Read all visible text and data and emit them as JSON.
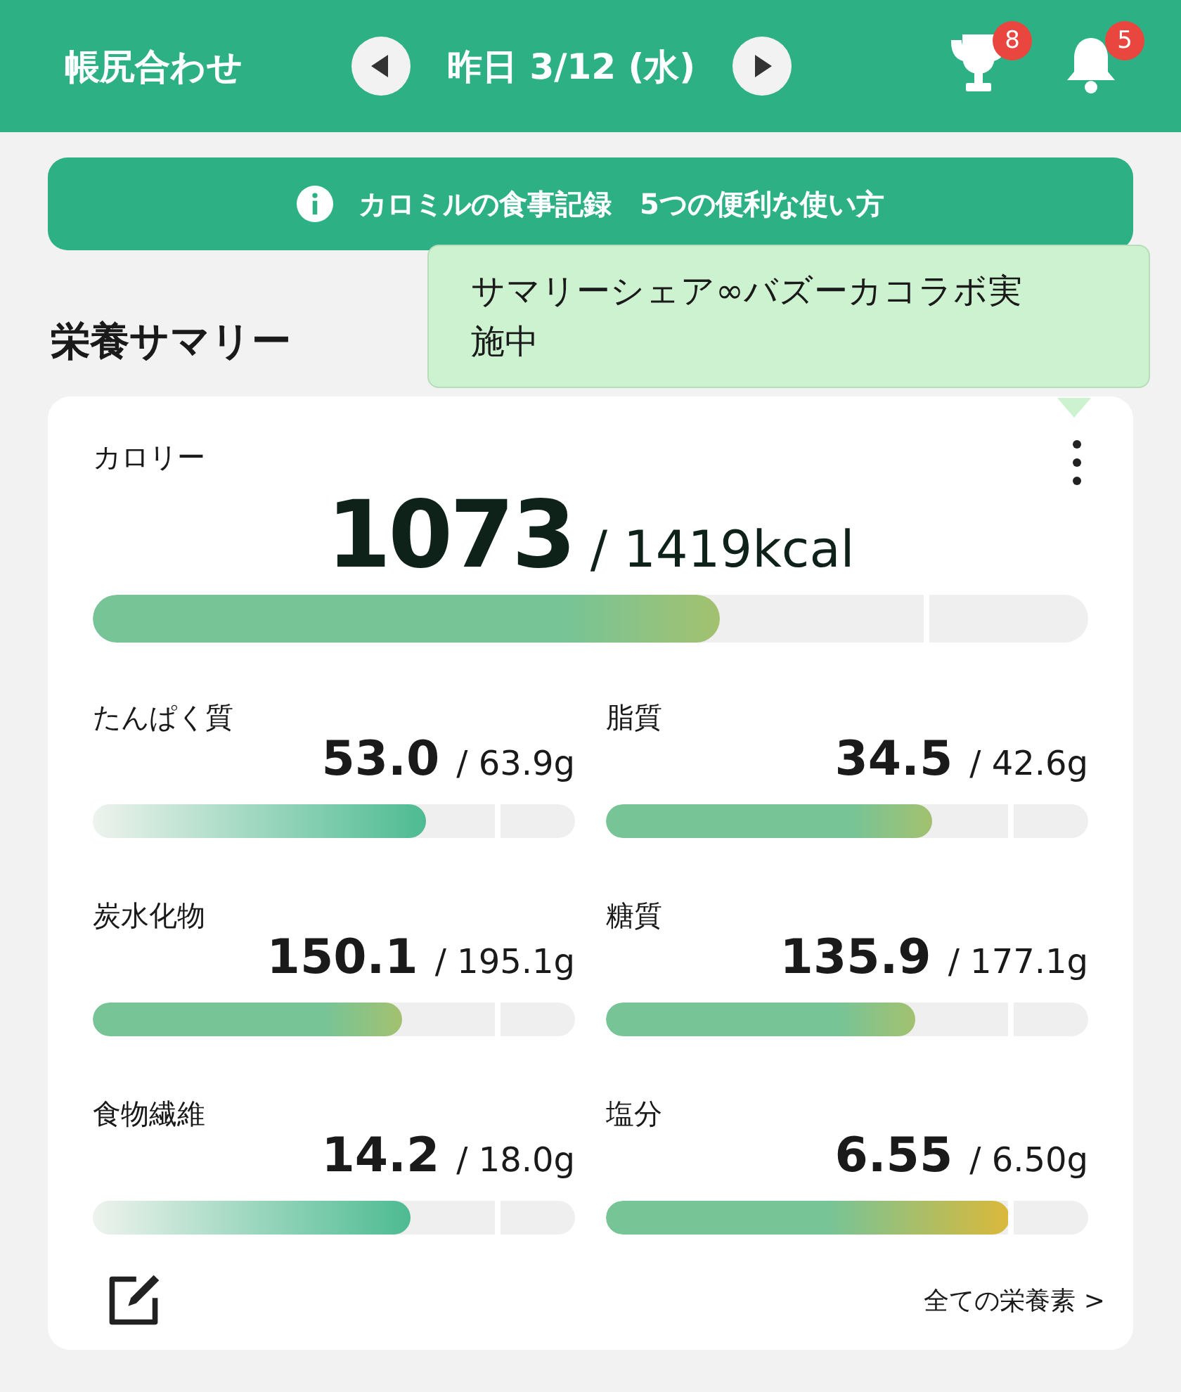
{
  "header": {
    "title": "帳尻合わせ",
    "date": "昨日 3/12 (水)",
    "trophy_badge": "8",
    "bell_badge": "5"
  },
  "banner": {
    "text": "カロミルの食事記録　5つの便利な使い方"
  },
  "section_title": "栄養サマリー",
  "tooltip": {
    "text": "サマリーシェア∞バズーカコラボ実施中"
  },
  "calorie": {
    "label": "カロリー",
    "value": "1073",
    "target": "/ 1419kcal",
    "level": 0.63,
    "kind": "good"
  },
  "nutrients": [
    {
      "label": "たんぱく質",
      "value": "53.0",
      "target": "/ 63.9g",
      "level": 0.69,
      "kind": "low"
    },
    {
      "label": "脂質",
      "value": "34.5",
      "target": "/ 42.6g",
      "level": 0.675,
      "kind": "good"
    },
    {
      "label": "炭水化物",
      "value": "150.1",
      "target": "/ 195.1g",
      "level": 0.64,
      "kind": "good"
    },
    {
      "label": "糖質",
      "value": "135.9",
      "target": "/ 177.1g",
      "level": 0.64,
      "kind": "good"
    },
    {
      "label": "食物繊維",
      "value": "14.2",
      "target": "/ 18.0g",
      "level": 0.66,
      "kind": "low"
    },
    {
      "label": "塩分",
      "value": "6.55",
      "target": "/ 6.50g",
      "level": 0.836,
      "kind": "over"
    }
  ],
  "all_link": "全ての栄養素 >"
}
